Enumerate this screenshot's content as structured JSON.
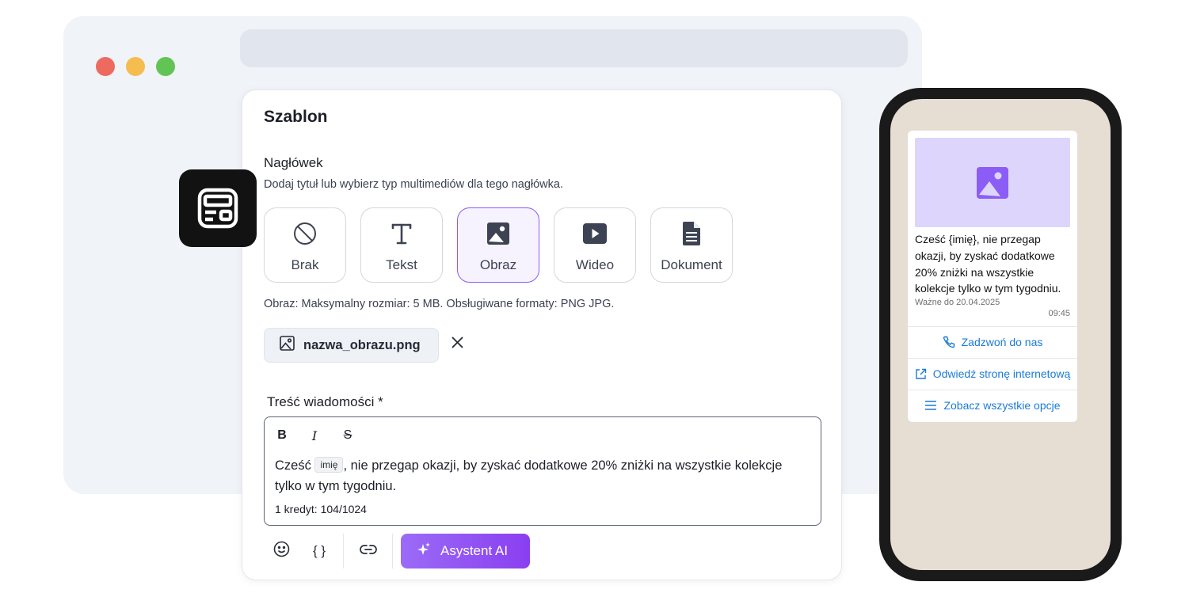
{
  "card": {
    "title": "Szablon",
    "header_label": "Nagłówek",
    "header_desc": "Dodaj tytuł lub wybierz typ multimediów dla tego nagłówka.",
    "header_types": [
      {
        "label": "Brak",
        "icon": "no-entry-icon"
      },
      {
        "label": "Tekst",
        "icon": "text-icon"
      },
      {
        "label": "Obraz",
        "icon": "image-icon",
        "selected": true
      },
      {
        "label": "Wideo",
        "icon": "video-icon"
      },
      {
        "label": "Dokument",
        "icon": "document-icon"
      }
    ],
    "format_note": "Obraz: Maksymalny rozmiar: 5 MB. Obsługiwane formaty: PNG JPG.",
    "file_name": "nazwa_obrazu.png",
    "body_label": "Treść wiadomości *",
    "message_before": "Cześć ",
    "variable": "imię",
    "message_after": ", nie przegap okazji, by zyskać dodatkowe 20% zniżki na wszystkie kolekcje tylko w tym tygodniu.",
    "credits": "1 kredyt: 104/1024",
    "format_buttons": {
      "bold": "B",
      "italic": "I",
      "strike": "S"
    },
    "braces": "{ }",
    "ai_button": "Asystent AI"
  },
  "phone": {
    "message": "Cześć {imię}, nie przegap okazji, by zyskać dodatkowe 20% zniżki na wszystkie kolekcje tylko w tym tygodniu.",
    "valid_until": "Ważne do 20.04.2025",
    "time": "09:45",
    "actions": [
      "Zadzwoń do nas",
      "Odwiedź stronę internetową",
      "Zobacz wszystkie opcje"
    ]
  },
  "colors": {
    "accent": "#8b5cf6",
    "ai_gradient_start": "#9b6bf7",
    "ai_gradient_end": "#8a3ff0",
    "link_blue": "#1b7bd6",
    "chat_background": "#e6ddd3",
    "image_placeholder": "#ddd5fc"
  }
}
